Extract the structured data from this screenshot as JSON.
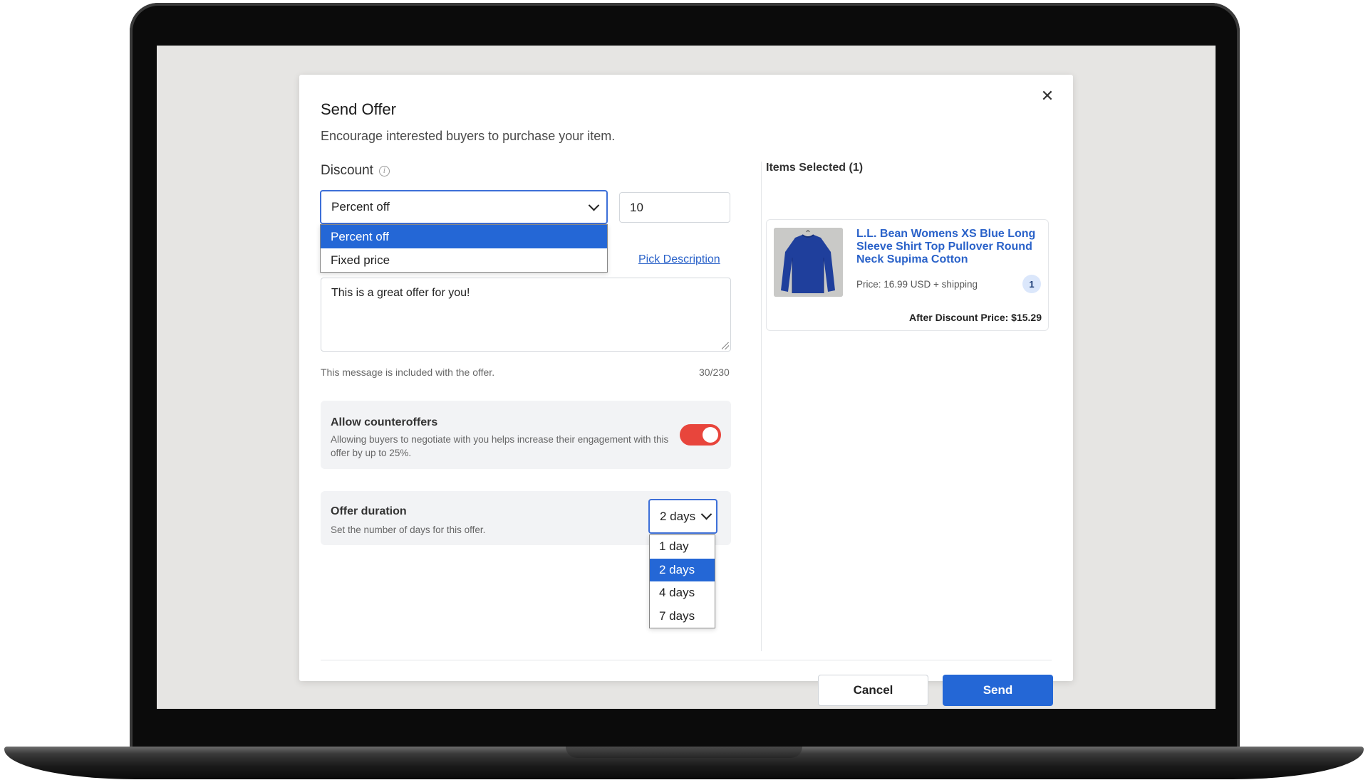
{
  "modal": {
    "title": "Send Offer",
    "subtitle": "Encourage interested buyers to purchase your item.",
    "close_icon": "close-icon"
  },
  "discount": {
    "label": "Discount",
    "info_icon": "info-icon",
    "type_selected": "Percent off",
    "type_options": [
      "Percent off",
      "Fixed price"
    ],
    "value": "10"
  },
  "message": {
    "pick_description_label": "Pick Description",
    "text": "This is a great offer for you!",
    "helper": "This message is included with the offer.",
    "counter": "30/230"
  },
  "counteroffers": {
    "title": "Allow counteroffers",
    "description": "Allowing buyers to negotiate with you helps increase their engagement with this offer by up to 25%.",
    "enabled": true,
    "toggle_color": "#e8453c"
  },
  "duration": {
    "title": "Offer duration",
    "description": "Set the number of days for this offer.",
    "selected": "2 days",
    "options": [
      "1 day",
      "2 days",
      "4 days",
      "7 days"
    ]
  },
  "items": {
    "title": "Items Selected (1)",
    "list": [
      {
        "name": "L.L. Bean Womens XS Blue Long Sleeve Shirt Top Pullover Round Neck Supima Cotton",
        "price": "Price: 16.99 USD + shipping",
        "quantity": "1",
        "after_discount": "After Discount Price: $15.29"
      }
    ]
  },
  "actions": {
    "cancel_label": "Cancel",
    "send_label": "Send"
  },
  "colors": {
    "accent": "#2467d6",
    "link": "#2a62c9"
  }
}
